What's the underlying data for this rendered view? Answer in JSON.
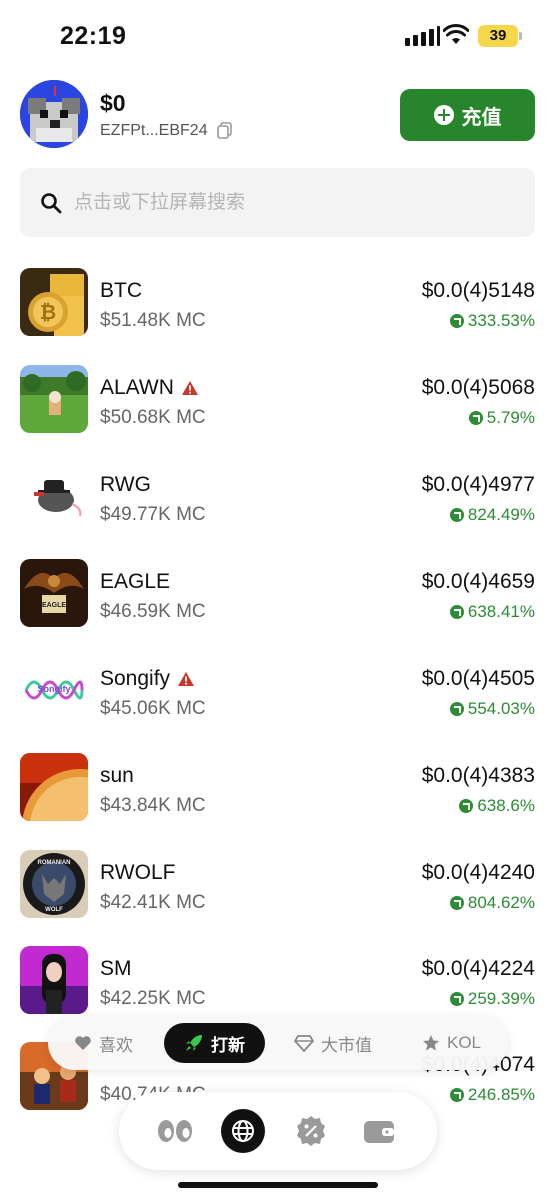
{
  "status_bar": {
    "time": "22:19",
    "battery": "39"
  },
  "header": {
    "balance": "$0",
    "address": "EZFPt...EBF24",
    "recharge_label": "充值"
  },
  "search": {
    "placeholder": "点击或下拉屏幕搜索"
  },
  "tokens": [
    {
      "name": "BTC",
      "mc": "$51.48K MC",
      "price": "$0.0(4)5148",
      "change": "333.53%",
      "warning": false
    },
    {
      "name": "ALAWN",
      "mc": "$50.68K MC",
      "price": "$0.0(4)5068",
      "change": "5.79%",
      "warning": true
    },
    {
      "name": "RWG",
      "mc": "$49.77K MC",
      "price": "$0.0(4)4977",
      "change": "824.49%",
      "warning": false
    },
    {
      "name": "EAGLE",
      "mc": "$46.59K MC",
      "price": "$0.0(4)4659",
      "change": "638.41%",
      "warning": false
    },
    {
      "name": "Songify",
      "mc": "$45.06K MC",
      "price": "$0.0(4)4505",
      "change": "554.03%",
      "warning": true
    },
    {
      "name": "sun",
      "mc": "$43.84K MC",
      "price": "$0.0(4)4383",
      "change": "638.6%",
      "warning": false
    },
    {
      "name": "RWOLF",
      "mc": "$42.41K MC",
      "price": "$0.0(4)4240",
      "change": "804.62%",
      "warning": false
    },
    {
      "name": "SM",
      "mc": "$42.25K MC",
      "price": "$0.0(4)4224",
      "change": "259.39%",
      "warning": false
    },
    {
      "name": "",
      "mc": "$40.74K MC",
      "price": "$0.0(4)4074",
      "change": "246.85%",
      "warning": false
    }
  ],
  "logo_texts": {
    "eagle": "EAGLE",
    "songify": "Songify",
    "rwolf_top": "ROMANIAN",
    "rwolf_bottom": "WOLF"
  },
  "filter_tabs": [
    {
      "label": "喜欢",
      "icon": "heart-icon"
    },
    {
      "label": "打新",
      "icon": "rocket-icon",
      "active": true
    },
    {
      "label": "大市值",
      "icon": "diamond-icon"
    },
    {
      "label": "KOL",
      "icon": "star-icon"
    }
  ],
  "bottom_nav": [
    {
      "icon": "eyes-icon"
    },
    {
      "icon": "globe-icon",
      "active": true
    },
    {
      "icon": "discount-badge-icon"
    },
    {
      "icon": "wallet-icon"
    }
  ],
  "colors": {
    "accent": "#27862c",
    "positive": "#2e8b36",
    "warning": "#c8372d"
  }
}
